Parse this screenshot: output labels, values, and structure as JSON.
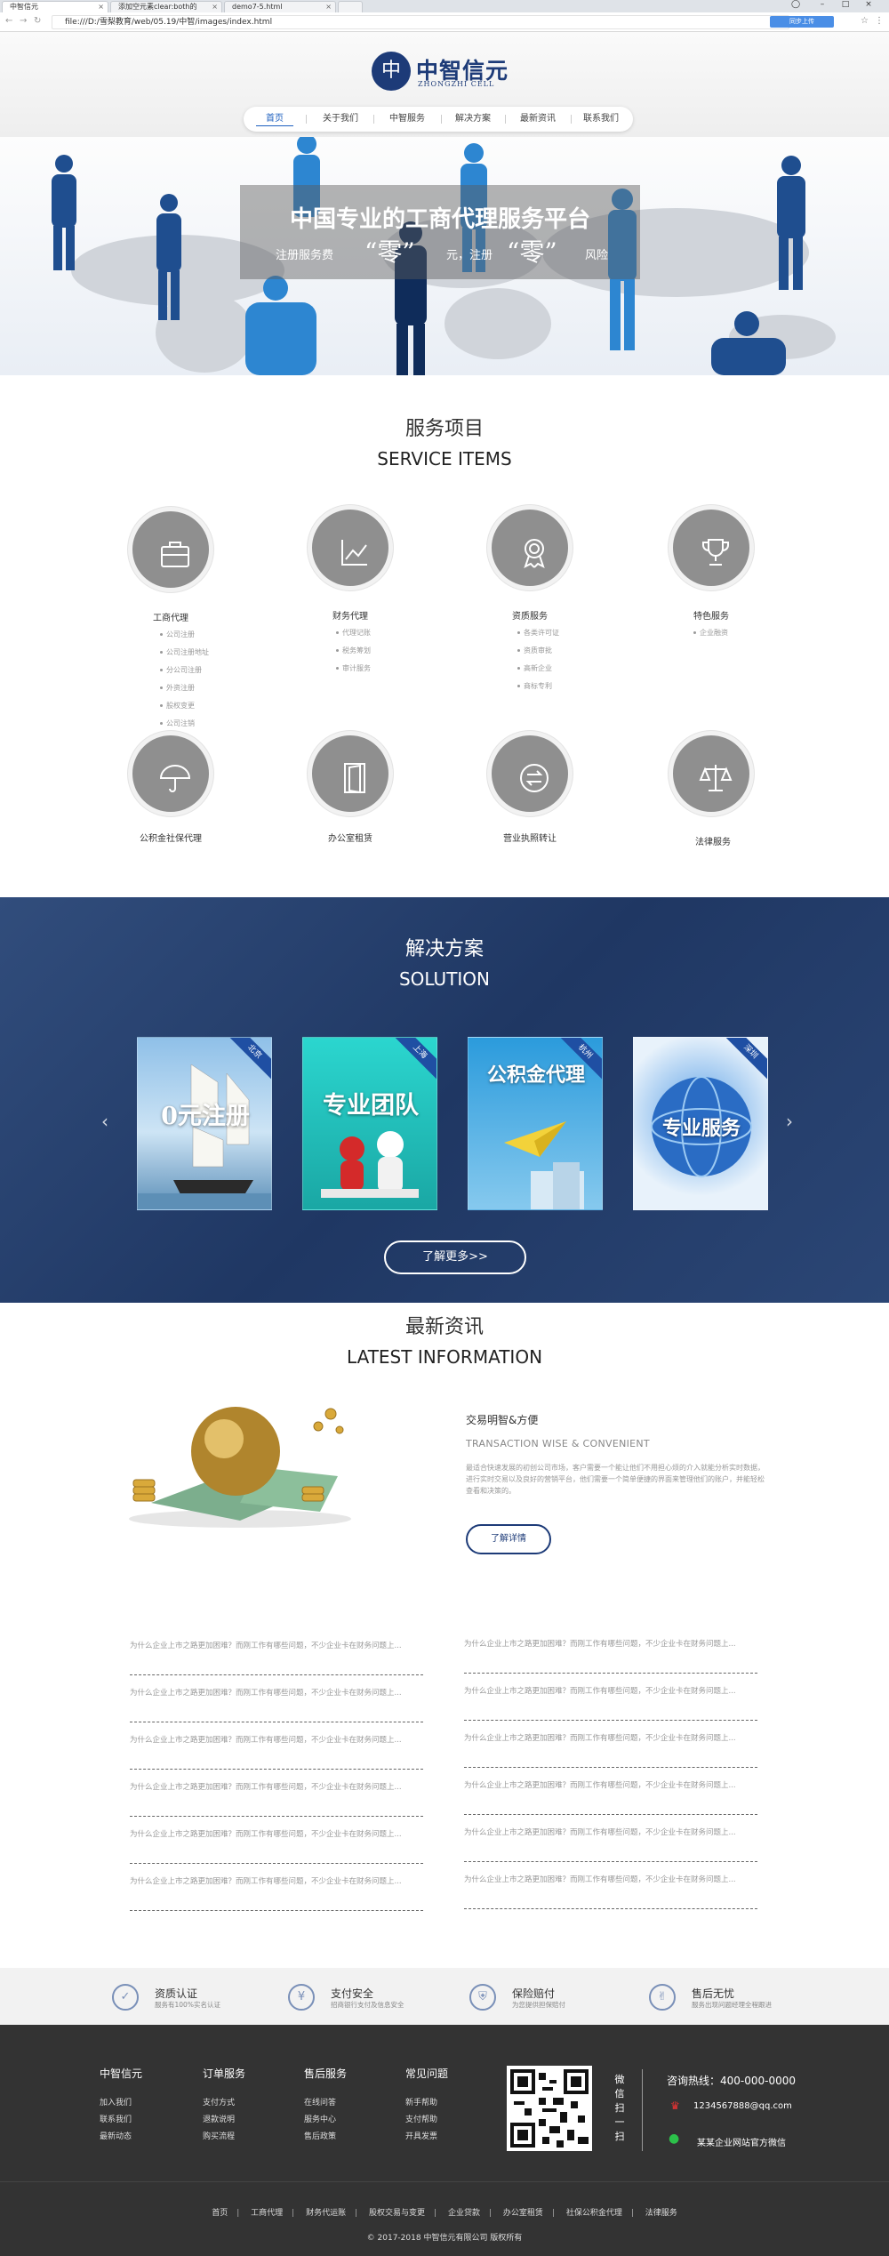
{
  "browser": {
    "tabs": [
      {
        "label": "中智信元",
        "active": true
      },
      {
        "label": "添加空元素clear:both的",
        "active": false
      },
      {
        "label": "demo7-5.html",
        "active": false
      }
    ],
    "url": "file:///D:/雪梨教育/web/05.19/中智/images/index.html",
    "upload_label": "同步上传"
  },
  "logo": {
    "mark": "中",
    "name": "中智信元",
    "sub": "ZHONGZHI CELL",
    "color": "#1d3b78"
  },
  "nav": {
    "items": [
      "首页",
      "关于我们",
      "中智服务",
      "解决方案",
      "最新资讯",
      "联系我们"
    ],
    "active_index": 0
  },
  "banner": {
    "title": "中国专业的工商代理服务平台",
    "slogan_1": "注册服务费",
    "zero": "“零”",
    "slogan_2": "元，",
    "slogan_3": "注册",
    "slogan_4": "风险"
  },
  "services": {
    "title": "服务项目",
    "subtitle": "SERVICE ITEMS",
    "items": [
      {
        "name": "工商代理",
        "icon": "briefcase-icon",
        "subs": [
          "公司注册",
          "公司注册地址",
          "分公司注册",
          "外资注册",
          "股权变更",
          "公司注销"
        ]
      },
      {
        "name": "财务代理",
        "icon": "chart-icon",
        "subs": [
          "代理记账",
          "税务筹划",
          "审计服务"
        ]
      },
      {
        "name": "资质服务",
        "icon": "medal-icon",
        "subs": [
          "各类许可证",
          "资质审批",
          "高新企业",
          "商标专利"
        ]
      },
      {
        "name": "特色服务",
        "icon": "trophy-icon",
        "subs": [
          "企业融资"
        ]
      },
      {
        "name": "公积金社保代理",
        "icon": "umbrella-icon",
        "subs": []
      },
      {
        "name": "办公室租赁",
        "icon": "door-icon",
        "subs": []
      },
      {
        "name": "营业执照转让",
        "icon": "transfer-icon",
        "subs": []
      },
      {
        "name": "法律服务",
        "icon": "scales-icon",
        "subs": []
      }
    ]
  },
  "solution": {
    "title": "解决方案",
    "subtitle": "SOLUTION",
    "cards": [
      {
        "city": "北京",
        "text": "0元注册"
      },
      {
        "city": "上海",
        "text": "专业团队"
      },
      {
        "city": "杭州",
        "text": "公积金代理"
      },
      {
        "city": "深圳",
        "text": "专业服务"
      }
    ],
    "prev": "‹",
    "next": "›",
    "more_label": "了解更多>>"
  },
  "news": {
    "title": "最新资讯",
    "subtitle": "LATEST INFORMATION",
    "feature_title": "交易明智&方便",
    "feature_en": "TRANSACTION WISE & CONVENIENT",
    "feature_desc": "最适合快速发展的初创公司市场，客户需要一个能让他们不用担心烦的介入就能分析实时数据，进行实时交易以及良好的营销平台，他们需要一个简单便捷的界面来管理他们的账户，并能轻松查看和决策的。",
    "feature_button": "了解详情",
    "list_left": [
      "为什么企业上市之路更加困难？而刚工作有哪些问题，不少企业卡在财务问题上...",
      "为什么企业上市之路更加困难？而刚工作有哪些问题，不少企业卡在财务问题上...",
      "为什么企业上市之路更加困难？而刚工作有哪些问题，不少企业卡在财务问题上...",
      "为什么企业上市之路更加困难？而刚工作有哪些问题，不少企业卡在财务问题上...",
      "为什么企业上市之路更加困难？而刚工作有哪些问题，不少企业卡在财务问题上...",
      "为什么企业上市之路更加困难？而刚工作有哪些问题，不少企业卡在财务问题上..."
    ],
    "list_right": [
      "为什么企业上市之路更加困难？而刚工作有哪些问题，不少企业卡在财务问题上...",
      "为什么企业上市之路更加困难？而刚工作有哪些问题，不少企业卡在财务问题上...",
      "为什么企业上市之路更加困难？而刚工作有哪些问题，不少企业卡在财务问题上...",
      "为什么企业上市之路更加困难？而刚工作有哪些问题，不少企业卡在财务问题上...",
      "为什么企业上市之路更加困难？而刚工作有哪些问题，不少企业卡在财务问题上...",
      "为什么企业上市之路更加困难？而刚工作有哪些问题，不少企业卡在财务问题上..."
    ]
  },
  "features": [
    {
      "title": "资质认证",
      "sub": "服务有100%实名认证",
      "icon": "certificate-icon"
    },
    {
      "title": "支付安全",
      "sub": "招商银行支付及信息安全",
      "icon": "wallet-icon"
    },
    {
      "title": "保险赔付",
      "sub": "为您提供担保赔付",
      "icon": "shield-icon"
    },
    {
      "title": "售后无忧",
      "sub": "服务出现问题经理全程跟进",
      "icon": "thumbs-up-icon"
    }
  ],
  "footer": {
    "columns": [
      {
        "title": "中智信元",
        "links": [
          "加入我们",
          "联系我们",
          "最新动态"
        ]
      },
      {
        "title": "订单服务",
        "links": [
          "支付方式",
          "退款说明",
          "购买流程"
        ]
      },
      {
        "title": "售后服务",
        "links": [
          "在线问答",
          "服务中心",
          "售后政策"
        ]
      },
      {
        "title": "常见问题",
        "links": [
          "新手帮助",
          "支付帮助",
          "开具发票"
        ]
      }
    ],
    "qr_label": "微信扫一扫",
    "hotline": "咨询热线：400-000-0000",
    "qq": "1234567888@qq.com",
    "wechat": "某某企业网站官方微信",
    "bottom_links": [
      "首页",
      "工商代理",
      "财务代运账",
      "股权交易与变更",
      "企业贷款",
      "办公室租赁",
      "社保公积金代理",
      "法律服务"
    ],
    "copyright": "© 2017-2018 中智信元有限公司 版权所有"
  }
}
